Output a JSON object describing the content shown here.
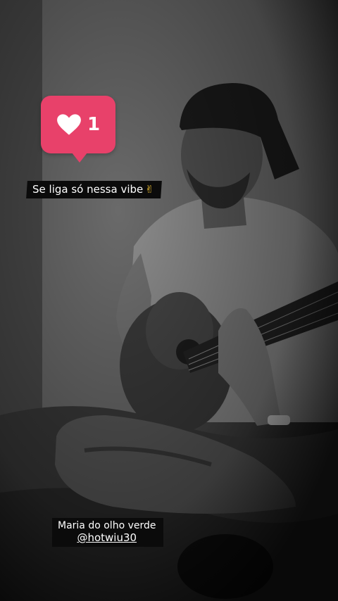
{
  "like_sticker": {
    "icon": "heart-icon",
    "count": "1",
    "color": "#e8416a"
  },
  "caption": {
    "text": "Se liga só nessa vibe",
    "emoji": "✌"
  },
  "credits": {
    "song": "Maria do olho verde",
    "handle": "@hotwiu30"
  }
}
